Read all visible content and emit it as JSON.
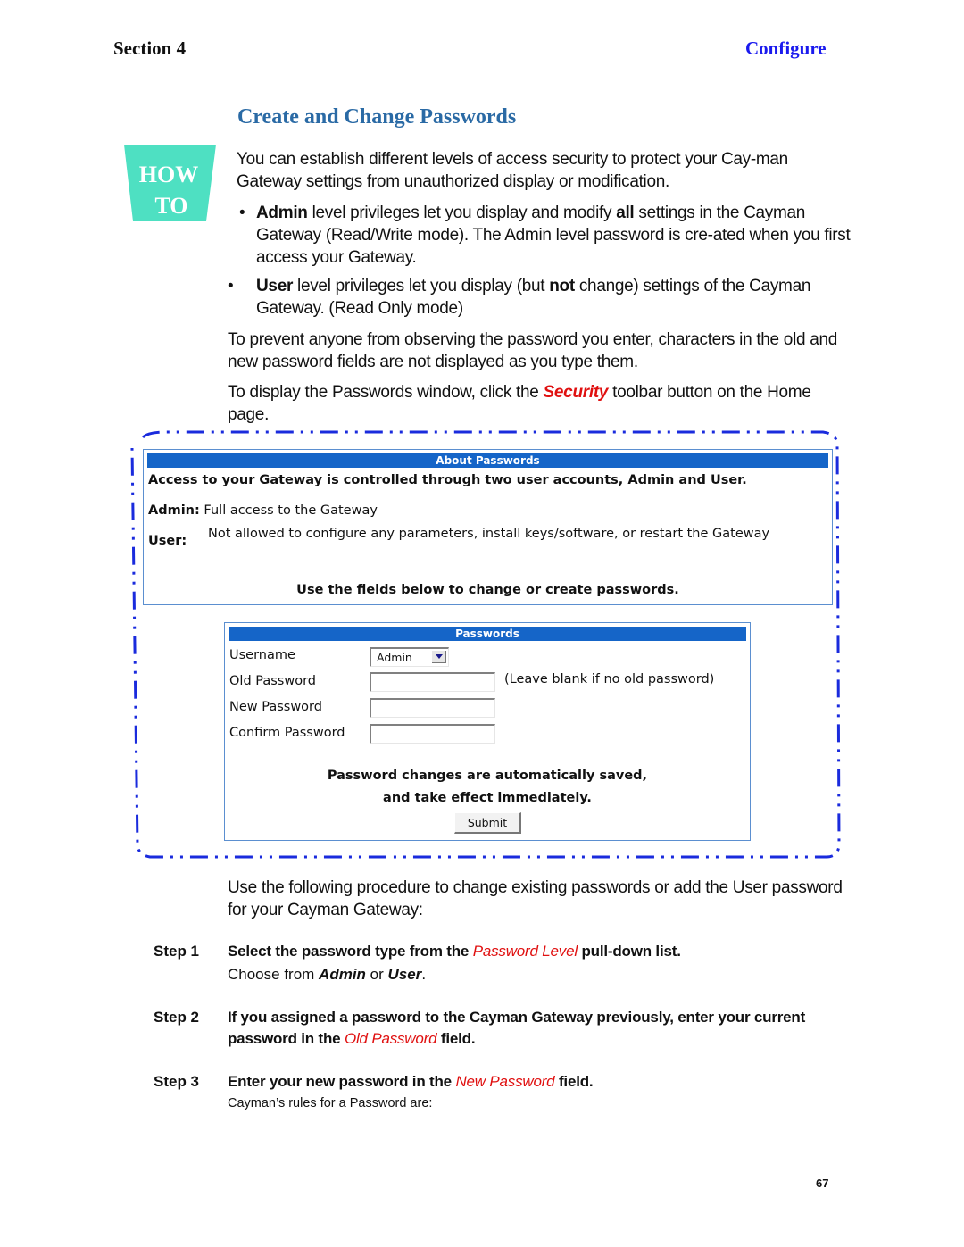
{
  "header": {
    "section": "Section 4",
    "chapter": "Configure"
  },
  "title": "Create and Change Passwords",
  "howto_badge": {
    "line1": "HOW",
    "line2": "TO",
    "color": "#4ee0c2"
  },
  "intro": "You can establish different levels of access security to protect your Cay-man Gateway settings from unauthorized display or modification.",
  "bullets": [
    {
      "bold": "Admin",
      "text1": " level privileges let you display and modify ",
      "bold2": "all",
      "text2": " settings in the Cayman Gateway (Read/Write mode). The Admin level password is cre-ated when you first access your Gateway."
    },
    {
      "bold": "User",
      "text1": " level privileges let you display (but ",
      "bold2": "not",
      "text2": " change) settings of the Cayman Gateway. (Read Only mode)"
    }
  ],
  "para_prevent": "To prevent anyone from observing the password you enter, characters in the old and new password fields are not displayed as you type them.",
  "para_display": {
    "before": "To display the Passwords window, click the ",
    "link": "Security",
    "after": " toolbar button on the Home page."
  },
  "about_panel": {
    "heading": "About Passwords",
    "line1": "Access to your Gateway is controlled through two user accounts, Admin and User.",
    "admin_label": "Admin:",
    "admin_text": "Full access to the Gateway",
    "user_label": "User:",
    "user_text": "Not allowed to configure any parameters, install keys/software, or restart the Gateway",
    "footer": "Use the fields below to change or create passwords."
  },
  "passwords_panel": {
    "heading": "Passwords",
    "username_label": "Username",
    "username_value": "Admin",
    "old_label": "Old Password",
    "old_hint": "(Leave blank if no old password)",
    "new_label": "New Password",
    "confirm_label": "Confirm Password",
    "notice1": "Password changes are automatically saved,",
    "notice2": "and take effect immediately.",
    "submit": "Submit"
  },
  "procedure_intro": "Use the following procedure to change existing passwords or add the User password for your Cayman Gateway:",
  "steps": [
    {
      "label": "Step 1",
      "before": "Select the password type from the ",
      "link": "Password Level",
      "after": " pull-down list.",
      "sub_before": "Choose from ",
      "sub_b1": "Admin",
      "sub_mid": " or ",
      "sub_b2": "User",
      "sub_after": "."
    },
    {
      "label": "Step 2",
      "before": "If you assigned a password to the Cayman Gateway previously, enter your current password in the ",
      "link": "Old Password",
      "after": " field."
    },
    {
      "label": "Step 3",
      "before": "Enter your new password in the ",
      "link": "New Password",
      "after": " field.",
      "sub": "Cayman’s rules for a Password are:"
    }
  ],
  "page_number": "67"
}
